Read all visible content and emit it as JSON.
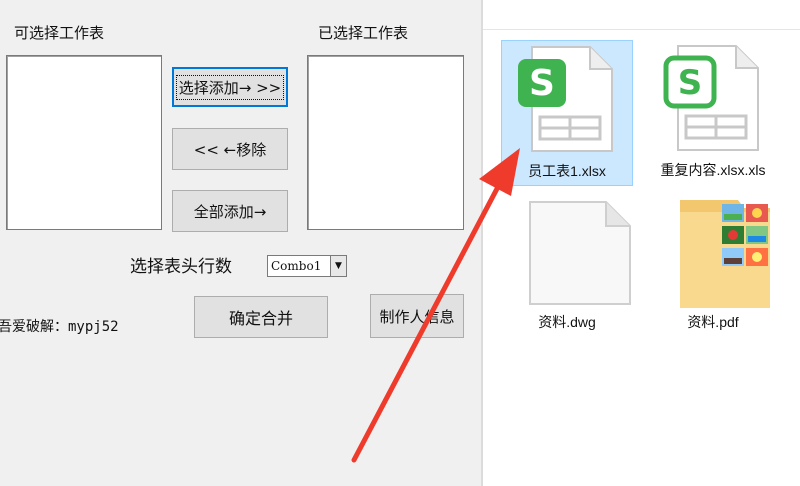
{
  "dialog": {
    "available_label": "可选择工作表",
    "selected_label": "已选择工作表",
    "add_selected_btn": "选择添加→ >>",
    "remove_btn": "<< ←移除",
    "add_all_btn": "全部添加→",
    "header_rows_label": "选择表头行数",
    "combo_value": "Combo1",
    "credit_text": "吾爱破解：mypj52",
    "merge_btn": "确定合并",
    "author_btn": "制作人信息"
  },
  "explorer": {
    "files": [
      {
        "name": "员工表1.xlsx",
        "icon": "spreadsheet-icon",
        "selected": true
      },
      {
        "name": "重复内容.xlsx.xls",
        "icon": "spreadsheet-icon",
        "selected": false
      },
      {
        "name": "资料.dwg",
        "icon": "blank-file-icon",
        "selected": false
      },
      {
        "name": "资料.pdf",
        "icon": "picture-folder-icon",
        "selected": false
      }
    ]
  },
  "colors": {
    "dialog_bg": "#f0f0f0",
    "accent": "#0078d7",
    "spreadsheet_green": "#3fb34f",
    "arrow_red": "#ee3b2c",
    "selection_bg": "#cce8ff"
  }
}
